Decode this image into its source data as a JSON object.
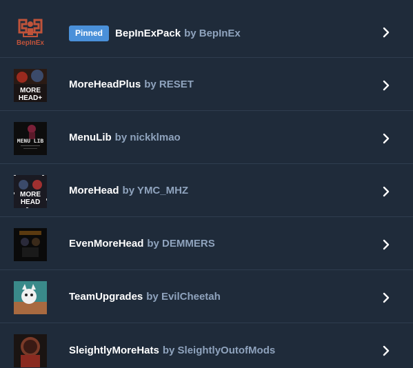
{
  "mods": [
    {
      "name": "BepInExPack",
      "by_label": "by BepInEx",
      "pinned": true,
      "badge": "Pinned",
      "icon": "bepinex-logo-icon",
      "logo_text": "BepInEx"
    },
    {
      "name": "MoreHeadPlus",
      "by_label": "by RESET",
      "pinned": false,
      "icon": "moreheadplus-thumbnail",
      "logo_text": "MORE\nHEAD+"
    },
    {
      "name": "MenuLib",
      "by_label": "by nickklmao",
      "pinned": false,
      "icon": "menulib-thumbnail",
      "logo_text": "MENU LIB"
    },
    {
      "name": "MoreHead",
      "by_label": "by YMC_MHZ",
      "pinned": false,
      "icon": "morehead-thumbnail",
      "logo_text": "MORE\nHEAD"
    },
    {
      "name": "EvenMoreHead",
      "by_label": "by DEMMERS",
      "pinned": false,
      "icon": "evenmorehead-thumbnail"
    },
    {
      "name": "TeamUpgrades",
      "by_label": "by EvilCheetah",
      "pinned": false,
      "icon": "teamupgrades-thumbnail"
    },
    {
      "name": "SleightlyMoreHats",
      "by_label": "by SleightlyOutofMods",
      "pinned": false,
      "icon": "sleightlymorehats-thumbnail"
    }
  ],
  "colors": {
    "background": "#1f2b3a",
    "divider": "#2f3d4f",
    "badge": "#4a90d9",
    "name_text": "#ffffff",
    "author_text": "#8fa3bd"
  }
}
